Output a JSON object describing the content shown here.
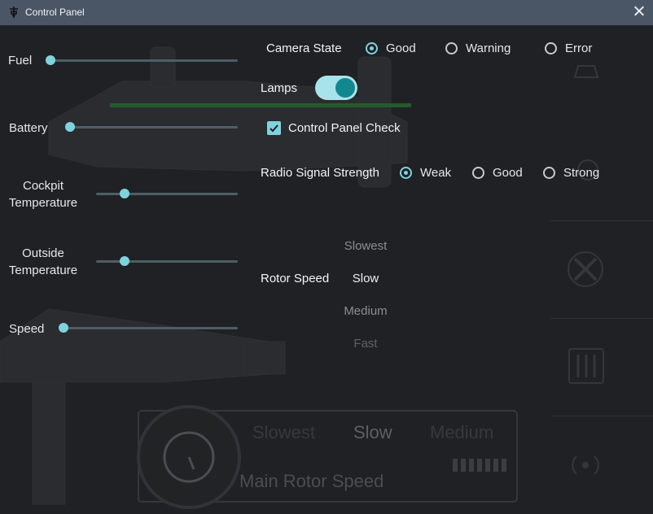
{
  "window": {
    "title": "Control Panel"
  },
  "sliders": {
    "fuel": {
      "label": "Fuel",
      "value": 0.0
    },
    "battery": {
      "label": "Battery",
      "value": 0.0
    },
    "cockpit_temperature": {
      "label_line1": "Cockpit",
      "label_line2": "Temperature",
      "value": 0.2
    },
    "outside_temperature": {
      "label_line1": "Outside",
      "label_line2": "Temperature",
      "value": 0.2
    },
    "speed": {
      "label": "Speed",
      "value": 0.0
    }
  },
  "camera_state": {
    "label": "Camera State",
    "options": [
      "Good",
      "Warning",
      "Error"
    ],
    "selected": "Good"
  },
  "lamps": {
    "label": "Lamps",
    "on": true
  },
  "control_panel_check": {
    "label": "Control Panel Check",
    "checked": true
  },
  "radio_signal": {
    "label": "Radio Signal Strength",
    "options": [
      "Weak",
      "Good",
      "Strong"
    ],
    "selected": "Weak"
  },
  "rotor_speed": {
    "label": "Rotor Speed",
    "options": [
      "Slowest",
      "Slow",
      "Medium",
      "Fast"
    ],
    "selected": "Slow"
  },
  "background_gauge": {
    "options": [
      "Slowest",
      "Slow",
      "Medium"
    ],
    "title": "Main Rotor Speed"
  },
  "sidebar_icons": [
    "camera-icon",
    "lamp-icon",
    "rotor-icon",
    "controls-icon",
    "signal-icon"
  ],
  "colors": {
    "accent": "#7fd3de",
    "toggle_track": "#a9e3ea",
    "toggle_knob": "#13878f",
    "titlebar": "#4a5566",
    "background": "#202124"
  }
}
